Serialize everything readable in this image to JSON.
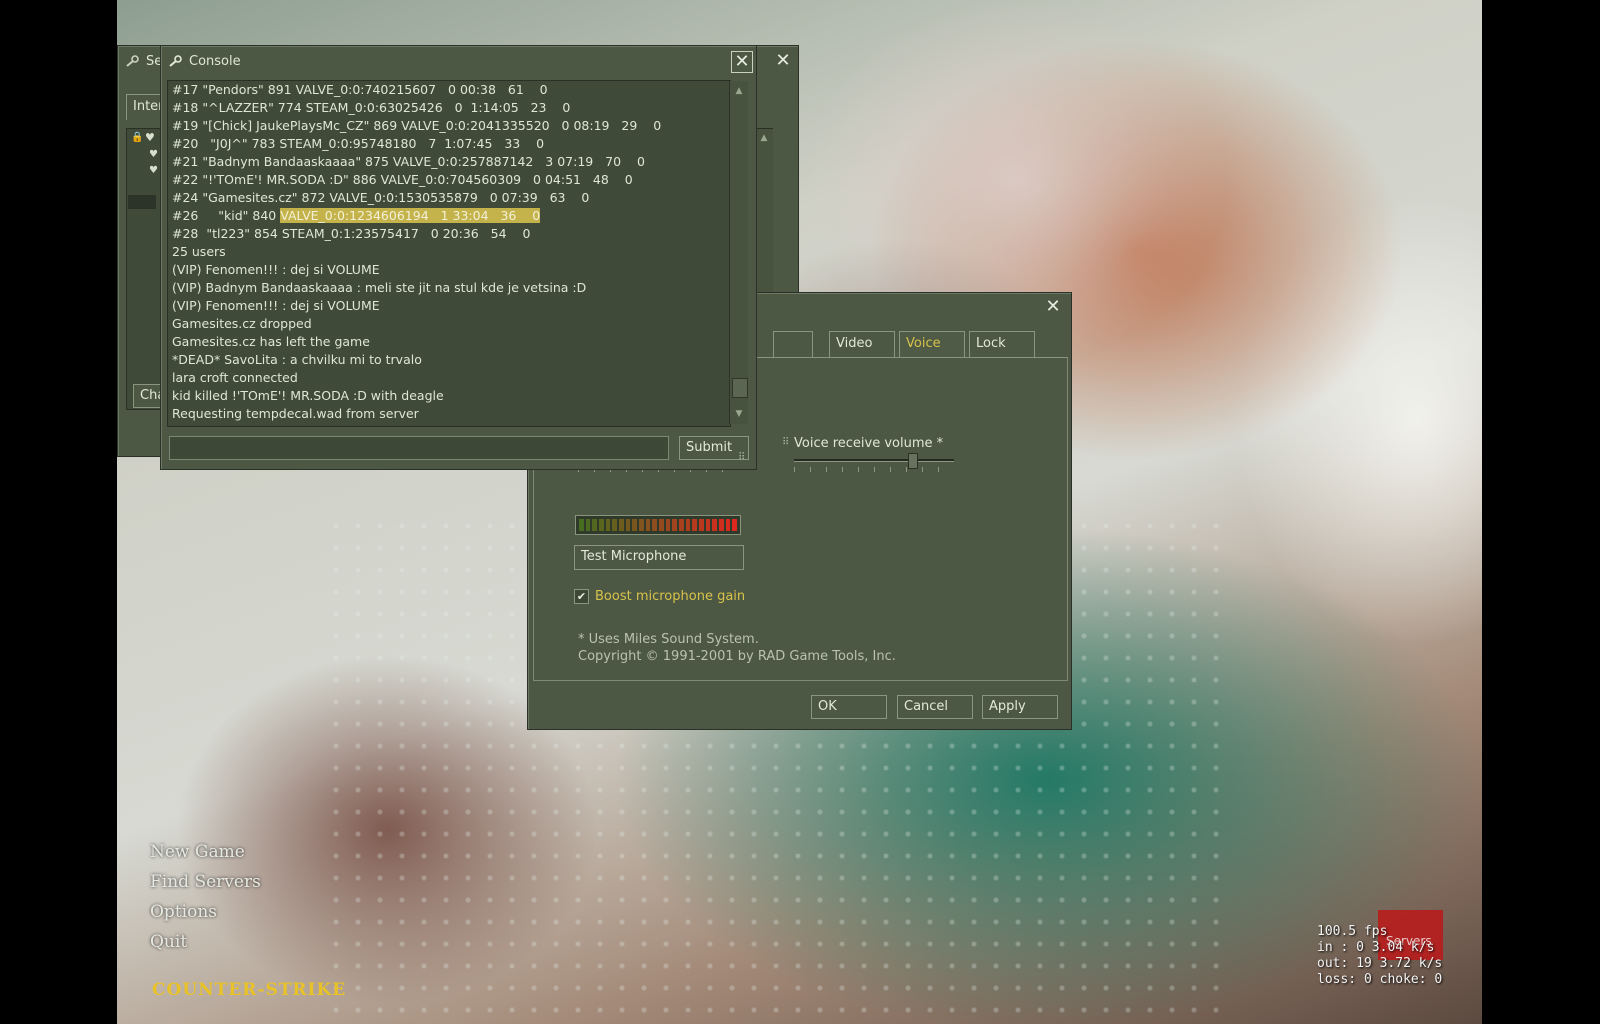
{
  "console": {
    "title": "Console",
    "log": [
      "#17 \"Pendors\" 891 VALVE_0:0:740215607   0 00:38   61    0",
      "#18 \"^LAZZER\" 774 STEAM_0:0:63025426   0  1:14:05   23    0",
      "#19 \"[Chick] JaukePlaysMc_CZ\" 869 VALVE_0:0:2041335520   0 08:19   29    0",
      "#20   \"J0J^\" 783 STEAM_0:0:95748180   7  1:07:45   33    0",
      "#21 \"Badnym Bandaaskaaaa\" 875 VALVE_0:0:257887142   3 07:19   70    0",
      "#22 \"!'TOmE'! MR.SODA :D\" 886 VALVE_0:0:704560309   0 04:51   48    0",
      "#24 \"Gamesites.cz\" 872 VALVE_0:0:1530535879   0 07:39   63    0",
      "#26     \"kid\" 840 ",
      "#28  \"tl223\" 854 STEAM_0:1:23575417   0 20:36   54    0",
      "25 users",
      "(VIP) Fenomen!!! : dej si VOLUME",
      "(VIP) Badnym Bandaaskaaaa : meli ste jit na stul kde je vetsina :D",
      "(VIP) Fenomen!!! : dej si VOLUME",
      "Gamesites.cz dropped",
      "Gamesites.cz has left the game",
      "*DEAD* SavoLita : a chvilku mi to trvalo",
      "lara croft connected",
      "kid killed !'TOmE'! MR.SODA :D with deagle",
      "Requesting tempdecal.wad from server"
    ],
    "log_highlight": "VALVE_0:0:1234606194   1 33:04   36    0",
    "input_value": "",
    "submit_label": "Submit"
  },
  "server_browser": {
    "title_fragment": "Se",
    "tab_fragment": "Inter",
    "button_fragment": "Cha",
    "button2_fragment": "t"
  },
  "options": {
    "tabs": [
      "Video",
      "Voice",
      "Lock"
    ],
    "active_tab": "Voice",
    "voice_receive_label": "Voice receive volume *",
    "voice_receive_level": 0.75,
    "test_mic_label": "Test Microphone",
    "boost_label": "Boost microphone gain",
    "boost_checked": true,
    "footnote": "* Uses Miles Sound System.",
    "copyright": "Copyright © 1991-2001 by RAD Game Tools, Inc.",
    "ok_label": "OK",
    "cancel_label": "Cancel",
    "apply_label": "Apply"
  },
  "main_menu": {
    "items": [
      "New Game",
      "Find Servers",
      "Options",
      "Quit"
    ],
    "logo_text": "COUNTER-STRIKE"
  },
  "netstats": {
    "fps": "100.5 fps",
    "in": "in :  0 3.04 k/s",
    "out": "out:  19 3.72 k/s",
    "loss": "loss: 0 choke:  0",
    "servers_fragment": "Servers"
  },
  "colors": {
    "panel": "#4c5844",
    "accent": "#d7c24a",
    "highlight": "#c4b34a"
  }
}
